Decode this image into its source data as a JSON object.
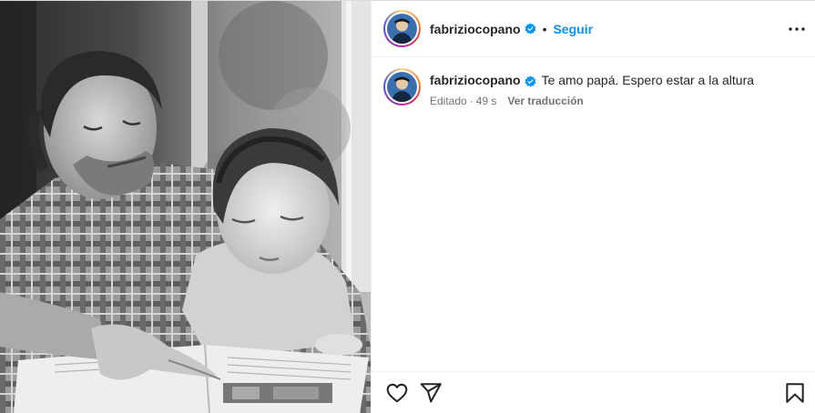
{
  "post": {
    "username": "fabriziocopano",
    "follow_label": "Seguir",
    "separator": "•",
    "caption_text": "Te amo papá. Espero estar a la altura",
    "edited_label": "Editado",
    "meta_separator": "·",
    "time_ago": "49 s",
    "translate_label": "Ver traducción"
  },
  "icons": {
    "verified": "verified-badge-icon",
    "more": "more-options-icon",
    "like": "heart-icon",
    "share": "paper-plane-icon",
    "save": "bookmark-icon"
  },
  "colors": {
    "follow_blue": "#0095f6",
    "verified_blue": "#0095f6",
    "text": "#262626",
    "secondary_text": "#737373",
    "border": "#efefef"
  }
}
